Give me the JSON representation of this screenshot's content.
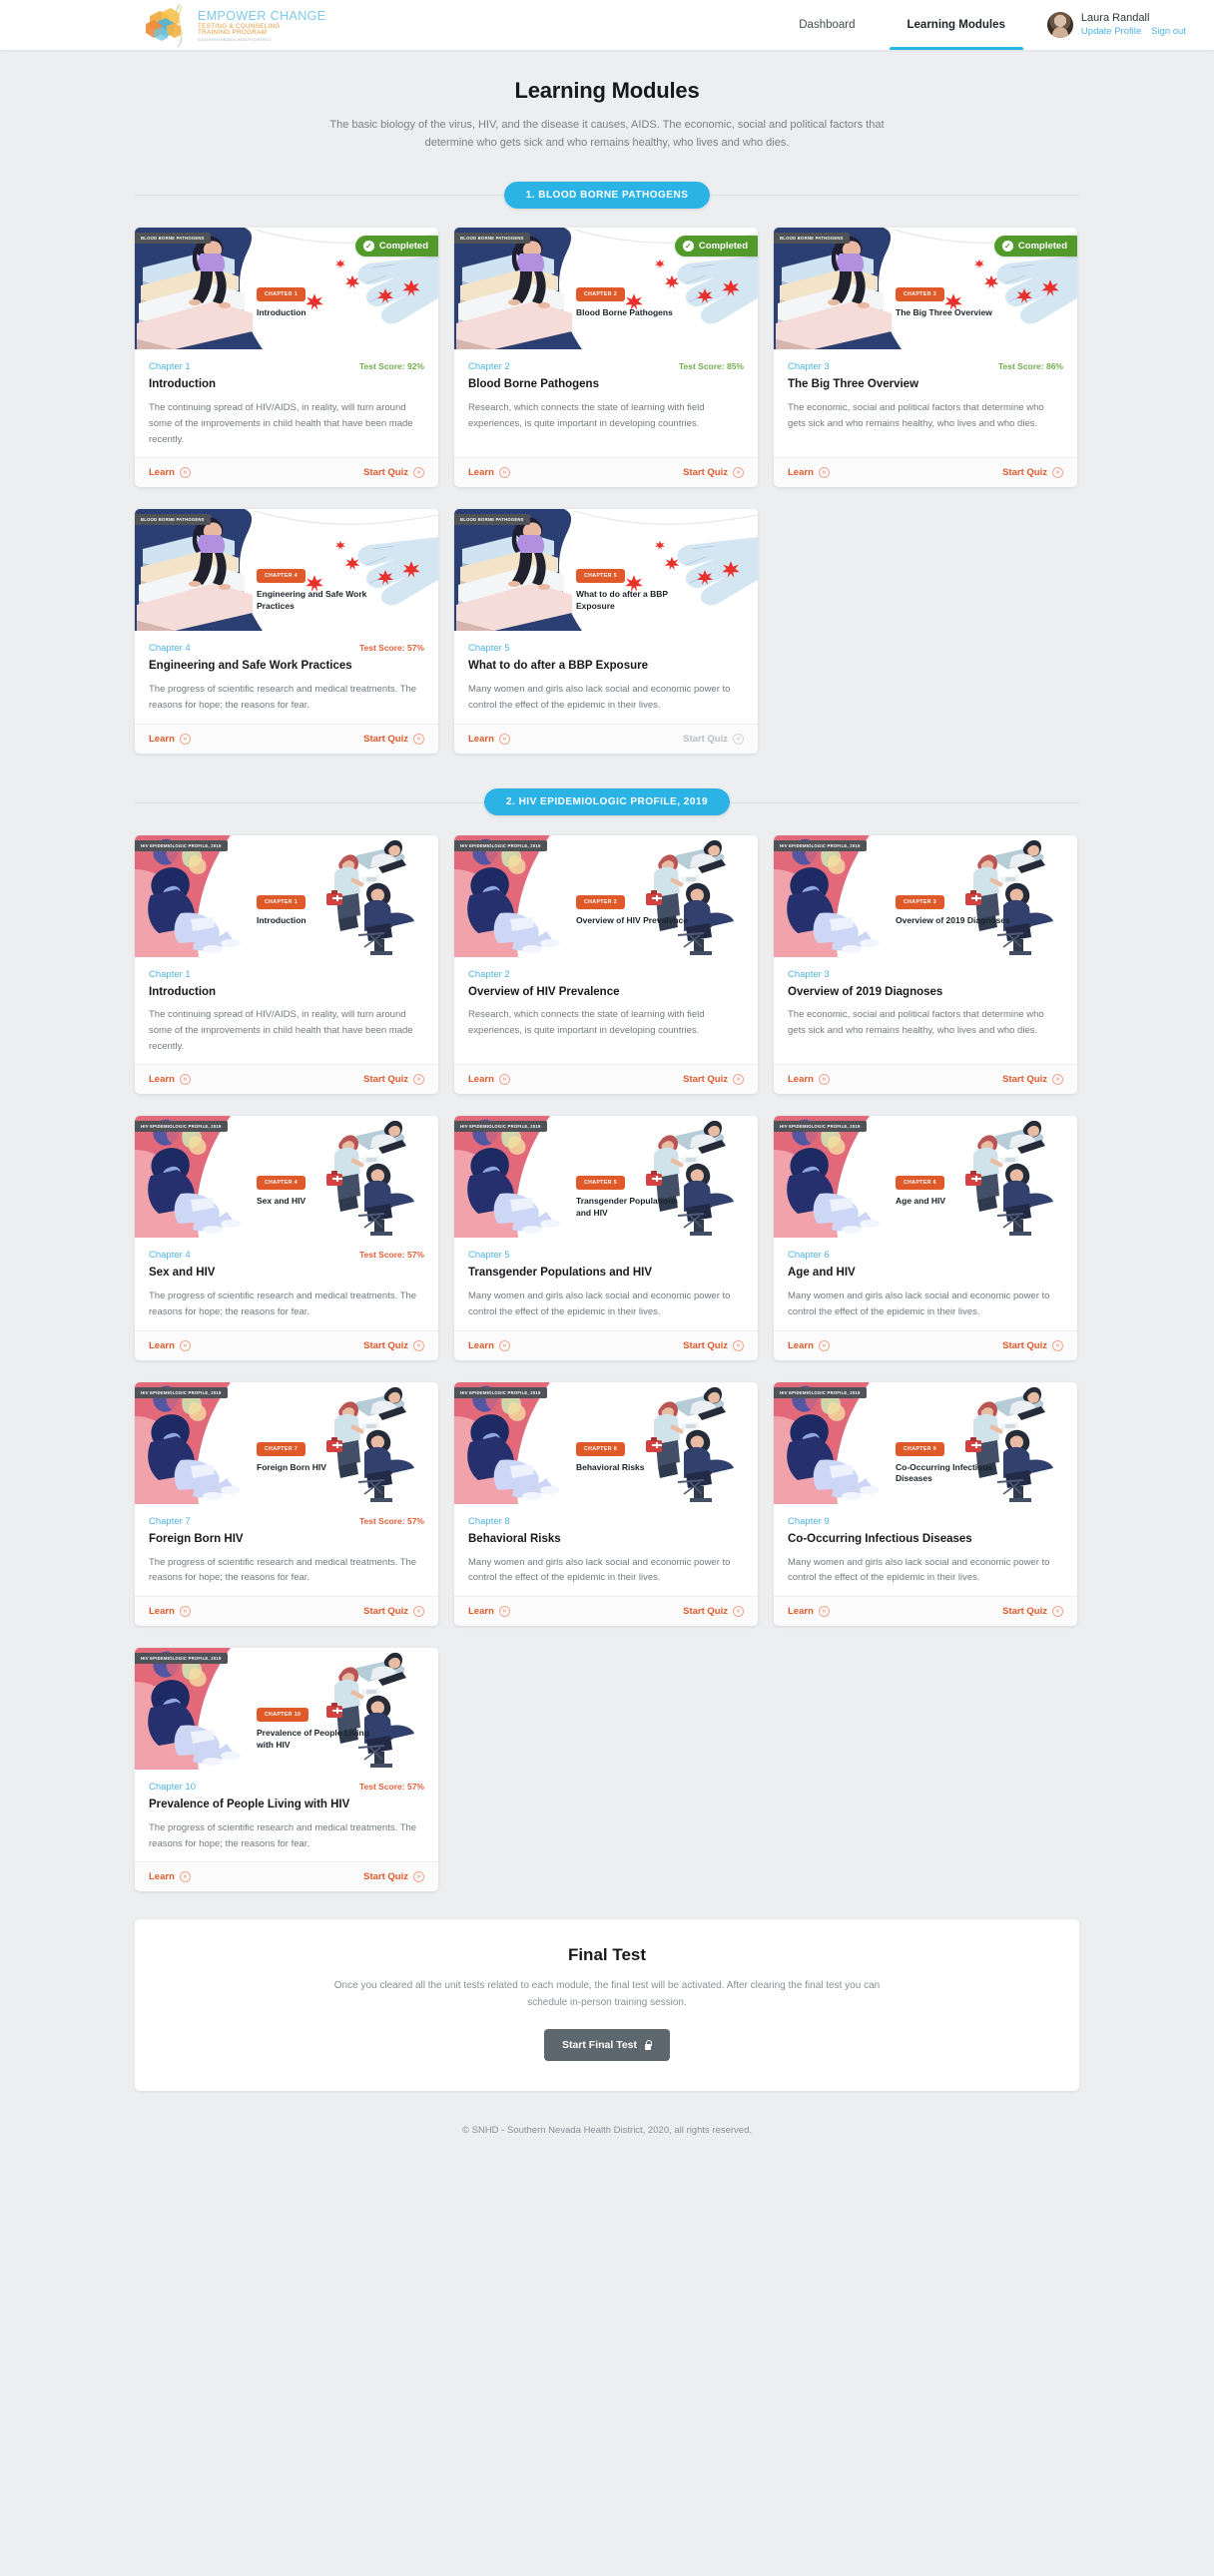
{
  "header": {
    "logo": {
      "title": "EMPOWER CHANGE",
      "sub1": "TESTING & COUNSELING",
      "sub2": "TRAINING PROGRAM",
      "sub3": "SOUTHERN NEVADA HEALTH DISTRICT"
    },
    "nav": [
      {
        "label": "Dashboard",
        "active": false
      },
      {
        "label": "Learning Modules",
        "active": true
      }
    ],
    "user": {
      "name": "Laura Randall",
      "update_profile": "Update Profile",
      "sign_out": "Sign out"
    }
  },
  "page": {
    "title": "Learning Modules",
    "subtitle": "The basic biology of the virus, HIV, and the disease it causes, AIDS.  The economic, social and political factors that determine who gets sick and who remains healthy, who lives and who dies."
  },
  "actions": {
    "learn": "Learn",
    "start_quiz": "Start Quiz",
    "arrow": "»",
    "completed": "Completed",
    "check": "✓"
  },
  "colors": {
    "accent_blue": "#2bb3e5",
    "orange": "#e05a29",
    "green": "#539a2c",
    "score_pass": "#6fae4a",
    "score_fail": "#e0603a",
    "page_bg": "#eceef0",
    "disabled": "#b8bdc1",
    "final_btn": "#5d676d"
  },
  "sections": [
    {
      "pill": "1. BLOOD BORNE PATHOGENS",
      "hero_tag": "BLOOD BORNE PATHOGENS",
      "art": "books",
      "cards": [
        {
          "chip": "CHAPTER 1",
          "hero_title": "Introduction",
          "chapter_label": "Chapter 1",
          "score": "Test Score: 92%",
          "score_state": "pass",
          "completed": true,
          "title": "Introduction",
          "desc": "The continuing spread of HIV/AIDS, in reality, will turn around some of the improvements in child health that have been made recently.",
          "quiz_disabled": false
        },
        {
          "chip": "CHAPTER 2",
          "hero_title": "Blood Borne Pathogens",
          "chapter_label": "Chapter 2",
          "score": "Test Score: 85%",
          "score_state": "pass",
          "completed": true,
          "title": "Blood Borne Pathogens",
          "desc": "Research, which connects the state of learning with field experiences, is quite important in developing countries.",
          "quiz_disabled": false
        },
        {
          "chip": "CHAPTER 3",
          "hero_title": "The Big Three Overview",
          "chapter_label": "Chapter 3",
          "score": "Test Score: 86%",
          "score_state": "pass",
          "completed": true,
          "title": "The Big Three Overview",
          "desc": "The economic, social and political factors that determine who gets sick and who remains healthy, who lives and who dies.",
          "quiz_disabled": false
        },
        {
          "chip": "CHAPTER 4",
          "hero_title": "Engineering and Safe Work Practices",
          "chapter_label": "Chapter 4",
          "score": "Test Score: 57%",
          "score_state": "fail",
          "completed": false,
          "title": "Engineering and Safe Work Practices",
          "desc": "The progress of scientific research and medical treatments.  The reasons for hope; the reasons for fear.",
          "quiz_disabled": false
        },
        {
          "chip": "CHAPTER 5",
          "hero_title": "What to do after a BBP Exposure",
          "chapter_label": "Chapter 5",
          "score": "",
          "score_state": "none",
          "completed": false,
          "title": "What to do after a BBP Exposure",
          "desc": "Many women and girls also lack social and economic power to control the effect of the epidemic in their lives.",
          "quiz_disabled": true
        }
      ]
    },
    {
      "pill": "2. HIV EPIDEMIOLOGIC PROFILE, 2019",
      "hero_tag": "HIV EPIDEMIOLOGIC PROFILE, 2019",
      "art": "clinic",
      "cards": [
        {
          "chip": "CHAPTER 1",
          "hero_title": "Introduction",
          "chapter_label": "Chapter 1",
          "score": "",
          "score_state": "none",
          "completed": false,
          "title": "Introduction",
          "desc": "The continuing spread of HIV/AIDS, in reality, will turn around some of the improvements in child health that have been made recently.",
          "quiz_disabled": false
        },
        {
          "chip": "CHAPTER 2",
          "hero_title": "Overview of HIV Prevalence",
          "chapter_label": "Chapter 2",
          "score": "",
          "score_state": "none",
          "completed": false,
          "title": "Overview of HIV Prevalence",
          "desc": "Research, which connects the state of learning with field experiences, is quite important in developing countries.",
          "quiz_disabled": false
        },
        {
          "chip": "CHAPTER 3",
          "hero_title": "Overview of 2019 Diagnoses",
          "chapter_label": "Chapter 3",
          "score": "",
          "score_state": "none",
          "completed": false,
          "title": "Overview of 2019 Diagnoses",
          "desc": "The economic, social and political factors that determine who gets sick and who remains healthy, who lives and who dies.",
          "quiz_disabled": false
        },
        {
          "chip": "CHAPTER 4",
          "hero_title": "Sex and HIV",
          "chapter_label": "Chapter 4",
          "score": "Test Score: 57%",
          "score_state": "fail",
          "completed": false,
          "title": "Sex and HIV",
          "desc": "The progress of scientific research and medical treatments.  The reasons for hope; the reasons for fear.",
          "quiz_disabled": false
        },
        {
          "chip": "CHAPTER 5",
          "hero_title": "Transgender Populations and HIV",
          "chapter_label": "Chapter 5",
          "score": "",
          "score_state": "none",
          "completed": false,
          "title": "Transgender Populations and HIV",
          "desc": "Many women and girls also lack social and economic power to control the effect of the epidemic in their lives.",
          "quiz_disabled": false
        },
        {
          "chip": "CHAPTER 6",
          "hero_title": "Age and HIV",
          "chapter_label": "Chapter 6",
          "score": "",
          "score_state": "none",
          "completed": false,
          "title": "Age and HIV",
          "desc": "Many women and girls also lack social and economic power to control the effect of the epidemic in their lives.",
          "quiz_disabled": false
        },
        {
          "chip": "CHAPTER 7",
          "hero_title": "Foreign Born HIV",
          "chapter_label": "Chapter 7",
          "score": "Test Score: 57%",
          "score_state": "fail",
          "completed": false,
          "title": "Foreign Born HIV",
          "desc": "The progress of scientific research and medical treatments.  The reasons for hope; the reasons for fear.",
          "quiz_disabled": false
        },
        {
          "chip": "CHAPTER 8",
          "hero_title": "Behavioral Risks",
          "chapter_label": "Chapter 8",
          "score": "",
          "score_state": "none",
          "completed": false,
          "title": "Behavioral Risks",
          "desc": "Many women and girls also lack social and economic power to control the effect of the epidemic in their lives.",
          "quiz_disabled": false
        },
        {
          "chip": "CHAPTER 9",
          "hero_title": "Co-Occurring Infectious Diseases",
          "chapter_label": "Chapter 9",
          "score": "",
          "score_state": "none",
          "completed": false,
          "title": "Co-Occurring Infectious Diseases",
          "desc": "Many women and girls also lack social and economic power to control the effect of the epidemic in their lives.",
          "quiz_disabled": false
        },
        {
          "chip": "CHAPTER 10",
          "hero_title": "Prevalence of People Living with HIV",
          "chapter_label": "Chapter 10",
          "score": "Test Score: 57%",
          "score_state": "fail",
          "completed": false,
          "title": "Prevalence of People Living with HIV",
          "desc": "The progress of scientific research and medical treatments.  The reasons for hope; the reasons for fear.",
          "quiz_disabled": false
        }
      ]
    }
  ],
  "final_test": {
    "title": "Final Test",
    "subtitle": "Once you cleared all the unit tests related to each module, the final test will be activated. After clearing the final test you can schedule in-person training session.",
    "button": "Start Final Test",
    "locked": true
  },
  "footer": {
    "copyright": "© SNHD - Southern Nevada Health District, 2020, all rights reserved."
  }
}
